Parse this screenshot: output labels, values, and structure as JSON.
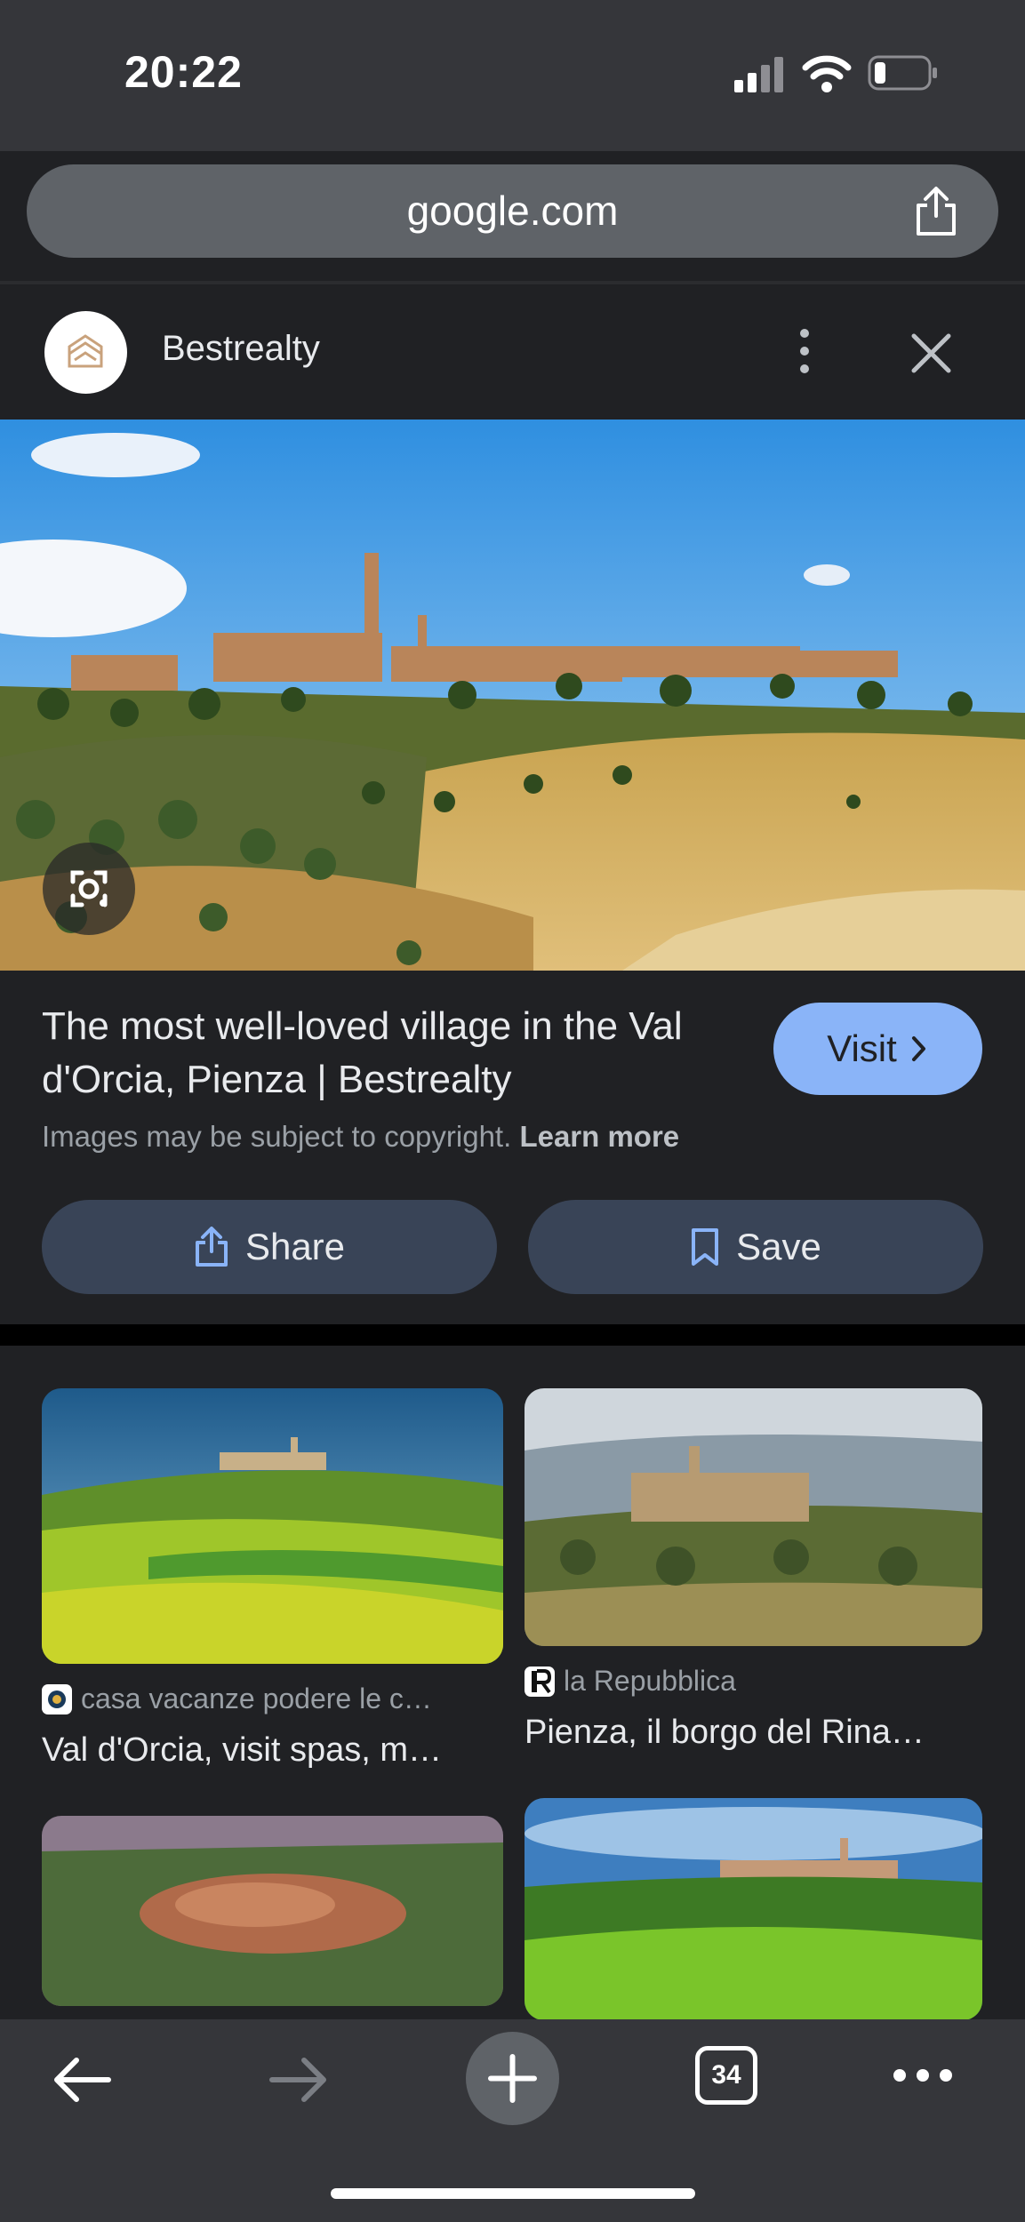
{
  "status_bar": {
    "time": "20:22"
  },
  "browser": {
    "url": "google.com",
    "open_tabs": "34"
  },
  "panel": {
    "site_name": "Bestrealty",
    "title": "The most well-loved village in the Val d'Orcia, Pienza | Bestrealty",
    "visit_label": "Visit",
    "copyright_text": "Images may be subject to copyright.",
    "learn_more": "Learn more",
    "share_label": "Share",
    "save_label": "Save"
  },
  "results": [
    {
      "source": "casa vacanze podere le c…",
      "caption": "Val d'Orcia, visit spas, m…"
    },
    {
      "source": "la Repubblica",
      "caption": "Pienza, il borgo del Rina…"
    }
  ],
  "colors": {
    "accent": "#8ab4f8",
    "pill_bg": "#394457",
    "bg": "#202124",
    "chrome": "#35363a"
  }
}
